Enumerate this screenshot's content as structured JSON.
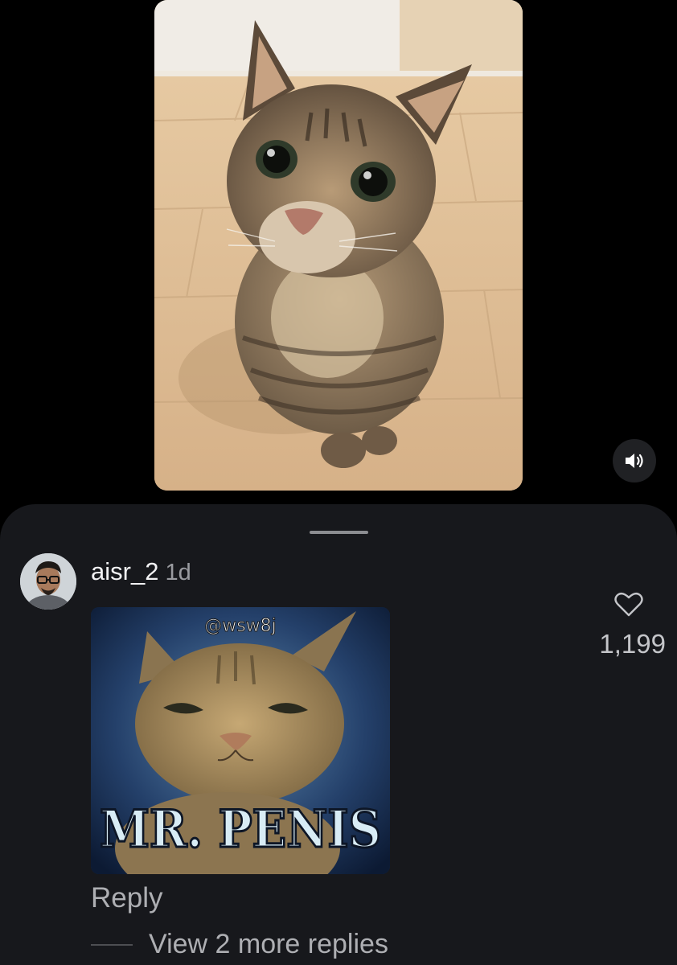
{
  "comments_sheet": {
    "comment": {
      "username": "aisr_2",
      "time": "1d",
      "like_count": "1,199",
      "image": {
        "watermark": "@wsw8j",
        "caption": "MR. PENIS"
      },
      "reply_label": "Reply",
      "view_replies_label": "View 2 more replies"
    }
  },
  "icons": {
    "sound": "speaker-volume-icon",
    "like": "heart-outline-icon"
  },
  "colors": {
    "background": "#000000",
    "sheet": "#17181c",
    "primary_text": "#f2f2f4",
    "secondary_text": "#aeafb3"
  }
}
